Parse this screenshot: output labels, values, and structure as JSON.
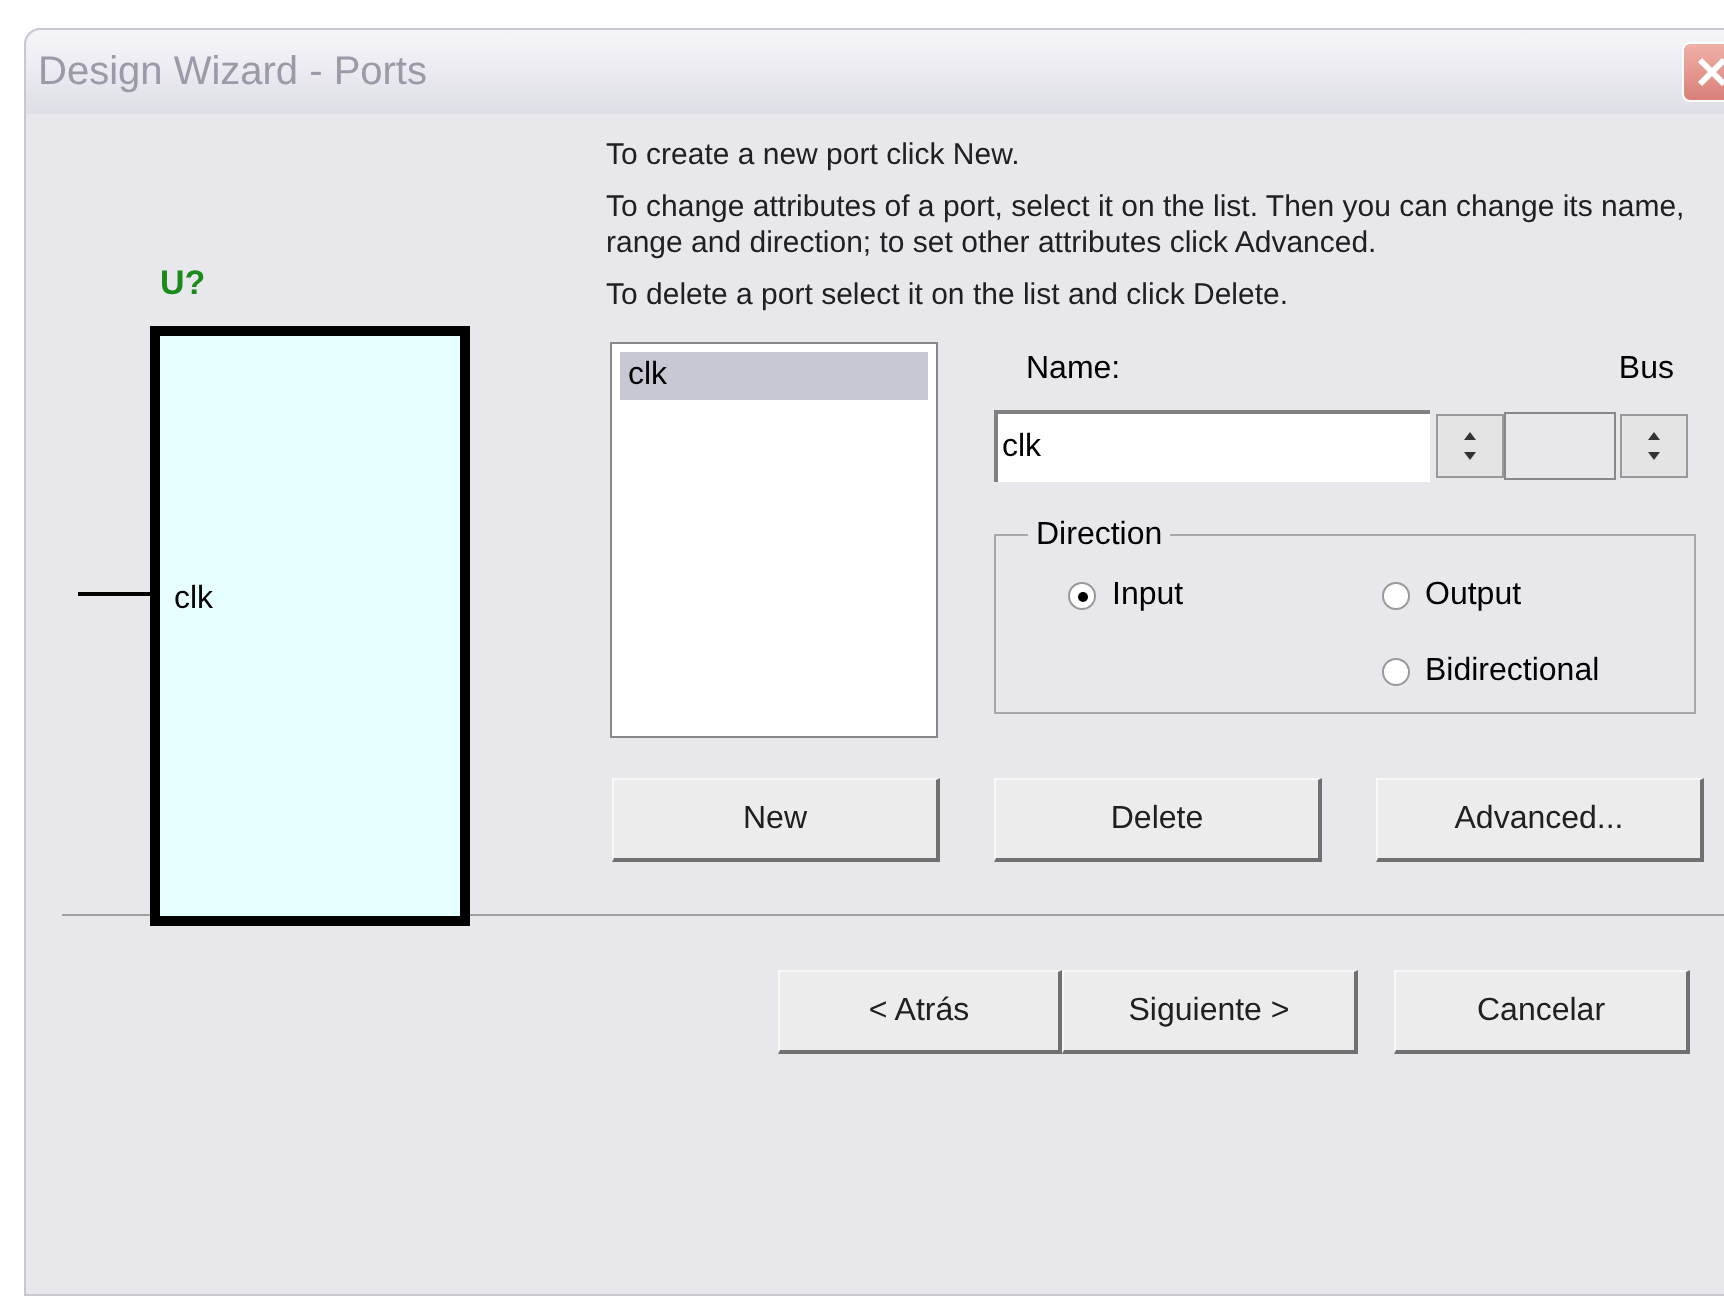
{
  "window": {
    "title": "Design Wizard - Ports"
  },
  "symbol": {
    "reference": "U?",
    "pins": [
      {
        "name": "clk"
      }
    ]
  },
  "instructions": [
    "To create a new port click New.",
    "To change attributes of a port, select it on the list. Then you can change its name, range and direction; to set other attributes click Advanced.",
    "To delete a port select it on the list and click Delete."
  ],
  "ports": [
    {
      "label": "clk",
      "selected": true
    }
  ],
  "name_label": "Name:",
  "bus_label": "Bus",
  "name_field": {
    "value": "clk"
  },
  "direction": {
    "label": "Direction",
    "options": [
      {
        "label": "Input",
        "selected": true
      },
      {
        "label": "Output",
        "selected": false
      },
      {
        "label": "Bidirectional",
        "selected": false
      }
    ]
  },
  "port_buttons": [
    "New",
    "Delete",
    "Advanced..."
  ],
  "nav_buttons": [
    "< Atrás",
    "Siguiente >",
    "Cancelar"
  ]
}
